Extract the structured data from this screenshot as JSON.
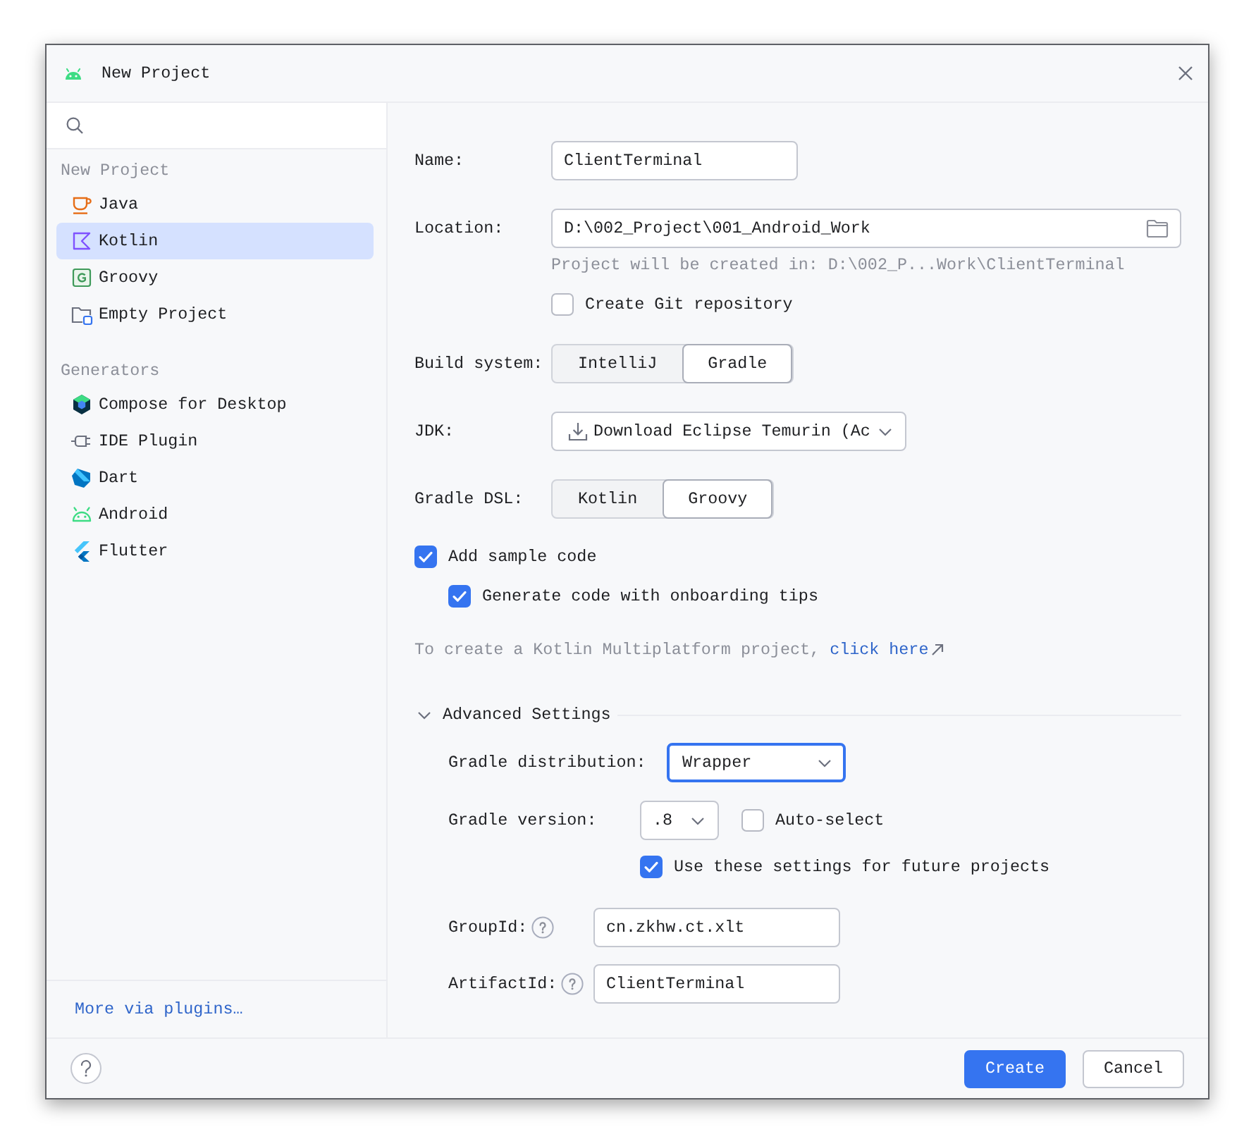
{
  "window": {
    "title": "New Project"
  },
  "sidebar": {
    "sections": [
      {
        "heading": "New Project",
        "items": [
          {
            "label": "Java",
            "kind": "java",
            "selected": false
          },
          {
            "label": "Kotlin",
            "kind": "kotlin",
            "selected": true
          },
          {
            "label": "Groovy",
            "kind": "groovy",
            "selected": false
          },
          {
            "label": "Empty Project",
            "kind": "empty",
            "selected": false
          }
        ]
      },
      {
        "heading": "Generators",
        "items": [
          {
            "label": "Compose for Desktop",
            "kind": "compose",
            "selected": false
          },
          {
            "label": "IDE Plugin",
            "kind": "plugin",
            "selected": false
          },
          {
            "label": "Dart",
            "kind": "dart",
            "selected": false
          },
          {
            "label": "Android",
            "kind": "android",
            "selected": false
          },
          {
            "label": "Flutter",
            "kind": "flutter",
            "selected": false
          }
        ]
      }
    ],
    "more_link": "More via plugins…"
  },
  "form": {
    "name": {
      "label": "Name:",
      "value": "ClientTerminal"
    },
    "location": {
      "label": "Location:",
      "value": "D:\\002_Project\\001_Android_Work",
      "hint": "Project will be created in: D:\\002_P...Work\\ClientTerminal"
    },
    "create_git": {
      "label": "Create Git repository",
      "checked": false
    },
    "build_system": {
      "label": "Build system:",
      "options": [
        {
          "label": "IntelliJ",
          "selected": false
        },
        {
          "label": "Gradle",
          "selected": true
        }
      ]
    },
    "jdk": {
      "label": "JDK:",
      "value": "Download Eclipse Temurin (Ac"
    },
    "gradle_dsl": {
      "label": "Gradle DSL:",
      "options": [
        {
          "label": "Kotlin",
          "selected": false
        },
        {
          "label": "Groovy",
          "selected": true
        }
      ]
    },
    "add_sample_code": {
      "label": "Add sample code",
      "checked": true
    },
    "onboarding_tips": {
      "label": "Generate code with onboarding tips",
      "checked": true
    },
    "multiplatform_note": {
      "text": "To create a Kotlin Multiplatform project,",
      "link": "click here"
    }
  },
  "advanced_settings": {
    "title": "Advanced Settings",
    "expanded": true,
    "gradle_distribution": {
      "label": "Gradle distribution:",
      "value": "Wrapper",
      "focused": true
    },
    "gradle_version": {
      "label": "Gradle version:",
      "value": ".8"
    },
    "auto_select": {
      "label": "Auto-select",
      "checked": false
    },
    "use_for_future": {
      "label": "Use these settings for future projects",
      "checked": true
    },
    "group_id": {
      "label": "GroupId:",
      "value": "cn.zkhw.ct.xlt"
    },
    "artifact_id": {
      "label": "ArtifactId:",
      "value": "ClientTerminal"
    }
  },
  "buttons": [
    {
      "label": "Create",
      "kind": "primary"
    },
    {
      "label": "Cancel",
      "kind": "secondary"
    }
  ]
}
